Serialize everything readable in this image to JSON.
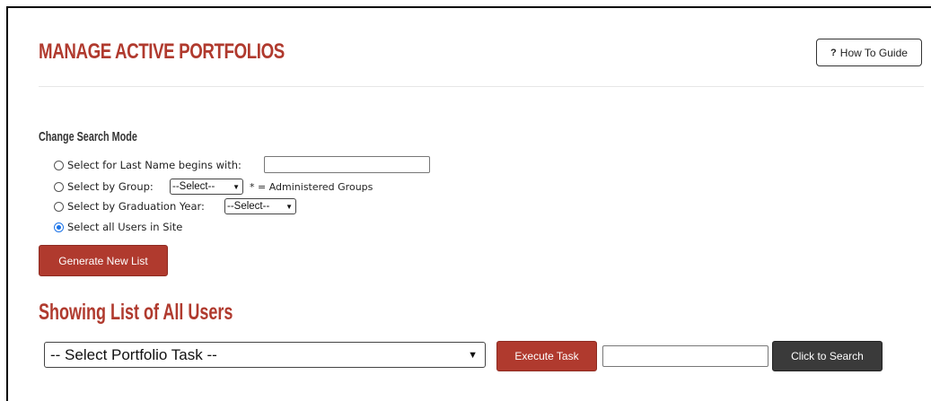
{
  "page": {
    "title": "MANAGE ACTIVE PORTFOLIOS",
    "how_to_guide": {
      "icon": "?",
      "label": "How To Guide"
    }
  },
  "search_mode": {
    "heading": "Change Search Mode",
    "options": [
      {
        "label": "Select for Last Name begins with:",
        "checked": false
      },
      {
        "label": "Select by Group:",
        "checked": false
      },
      {
        "label": "Select by Graduation Year:",
        "checked": false
      },
      {
        "label": "Select all Users in Site",
        "checked": true
      }
    ],
    "last_name_value": "",
    "group_select": "--Select--",
    "group_note": "* = Administered Groups",
    "year_select": "--Select--",
    "generate_label": "Generate New List"
  },
  "results": {
    "heading": "Showing List of All Users",
    "task_select": "-- Select Portfolio Task --",
    "execute_label": "Execute Task",
    "search_value": "",
    "search_label": "Click to Search"
  },
  "colors": {
    "accent": "#b03a2e",
    "dark_button": "#3a3a3a"
  }
}
